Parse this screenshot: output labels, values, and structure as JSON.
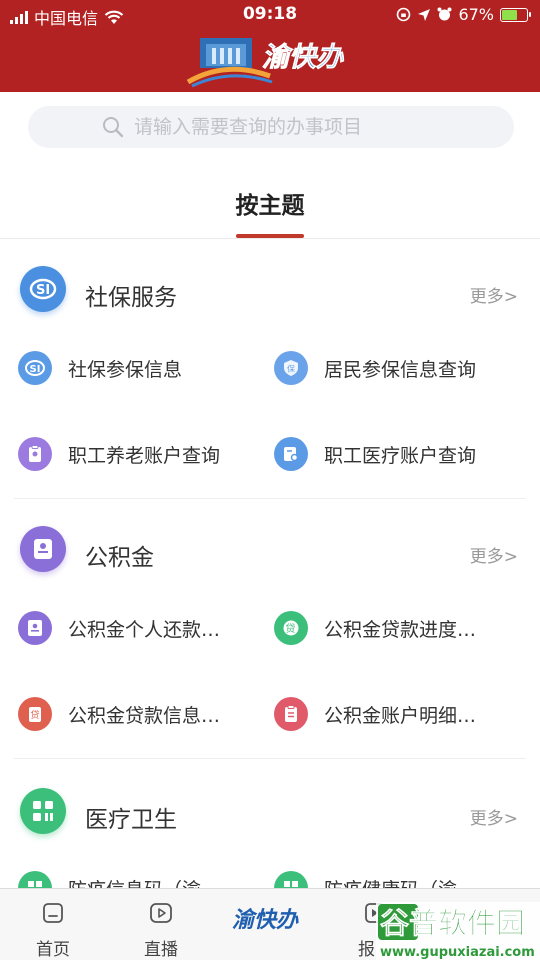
{
  "status_bar": {
    "carrier": "中国电信",
    "time": "09:18",
    "battery": "67%",
    "battery_level": 0.67
  },
  "header": {
    "logo_text": "渝快办"
  },
  "search": {
    "placeholder": "请输入需要查询的办事项目"
  },
  "tab": {
    "label": "按主题"
  },
  "sections": [
    {
      "title": "社保服务",
      "more": "更多>",
      "items": [
        "社保参保信息",
        "居民参保信息查询",
        "职工养老账户查询",
        "职工医疗账户查询"
      ]
    },
    {
      "title": "公积金",
      "more": "更多>",
      "items": [
        "公积金个人还款…",
        "公积金贷款进度…",
        "公积金贷款信息…",
        "公积金账户明细…"
      ]
    },
    {
      "title": "医疗卫生",
      "more": "更多>",
      "items": [
        "防疫信息码（渝",
        "防疫健康码（渝"
      ]
    }
  ],
  "bottom_nav": {
    "items": [
      {
        "label": "首页"
      },
      {
        "label": "直播"
      },
      {
        "label": "报"
      }
    ],
    "center_logo": "渝快办"
  },
  "watermark": {
    "brand": "谷普软件园",
    "url": "www.gupuxiazai.com"
  },
  "colors": {
    "header_bg": "#b22222",
    "accent": "#c0392b",
    "social_blue": "#4a90e2",
    "fund_purple": "#8b6fd8",
    "green": "#3cbf7a",
    "red_pink": "#e05a6a"
  }
}
